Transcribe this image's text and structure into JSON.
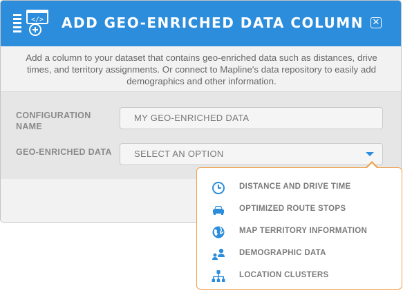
{
  "dialog": {
    "title": "ADD GEO-ENRICHED DATA COLUMN",
    "close_icon": "close-icon",
    "description": "Add a column to your dataset that contains geo-enriched data such as distances, drive times, and territory assignments. Or connect to Mapline's data repository to easily add demographics and other information."
  },
  "form": {
    "config_name_label": "CONFIGURATION NAME",
    "config_name_value": "MY GEO-ENRICHED DATA",
    "geo_data_label": "GEO-ENRICHED DATA",
    "geo_data_value": "SELECT AN OPTION"
  },
  "dropdown": {
    "options": [
      {
        "label": "DISTANCE AND DRIVE TIME",
        "icon": "clock-icon"
      },
      {
        "label": "OPTIMIZED ROUTE STOPS",
        "icon": "car-icon"
      },
      {
        "label": "MAP TERRITORY INFORMATION",
        "icon": "globe-icon"
      },
      {
        "label": "DEMOGRAPHIC DATA",
        "icon": "people-icon"
      },
      {
        "label": "LOCATION CLUSTERS",
        "icon": "hierarchy-icon"
      }
    ]
  },
  "colors": {
    "header": "#2b8ddb",
    "accent": "#2b8ddb",
    "dropdown_border": "#f0a04b"
  }
}
